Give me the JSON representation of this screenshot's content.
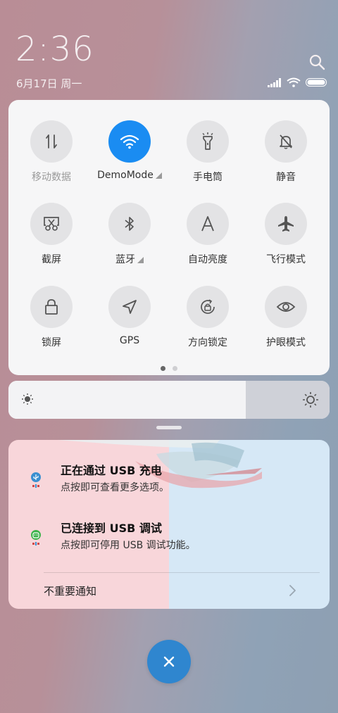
{
  "status": {
    "time": "2:36",
    "date": "6月17日 周一"
  },
  "quick_settings": {
    "tiles": [
      {
        "label": "移动数据",
        "icon": "mobile-data-icon",
        "active": false,
        "dim": true
      },
      {
        "label": "DemoMode",
        "icon": "wifi-icon",
        "active": true,
        "expand": true
      },
      {
        "label": "手电筒",
        "icon": "flashlight-icon",
        "active": false
      },
      {
        "label": "静音",
        "icon": "bell-off-icon",
        "active": false
      },
      {
        "label": "截屏",
        "icon": "screenshot-icon",
        "active": false
      },
      {
        "label": "蓝牙",
        "icon": "bluetooth-icon",
        "active": false,
        "expand": true
      },
      {
        "label": "自动亮度",
        "icon": "auto-brightness-icon",
        "active": false
      },
      {
        "label": "飞行模式",
        "icon": "airplane-icon",
        "active": false
      },
      {
        "label": "锁屏",
        "icon": "lock-icon",
        "active": false
      },
      {
        "label": "GPS",
        "icon": "location-icon",
        "active": false
      },
      {
        "label": "方向锁定",
        "icon": "rotation-lock-icon",
        "active": false
      },
      {
        "label": "护眼模式",
        "icon": "eye-icon",
        "active": false
      }
    ],
    "page_count": 2,
    "current_page": 1
  },
  "brightness": {
    "level": 0.74
  },
  "notifications": [
    {
      "title": "正在通过 USB 充电",
      "subtitle": "点按即可查看更多选项。",
      "icon": "usb-icon"
    },
    {
      "title": "已连接到 USB 调试",
      "subtitle": "点按即可停用 USB 调试功能。",
      "icon": "android-debug-icon"
    }
  ],
  "unimportant_label": "不重要通知",
  "colors": {
    "accent": "#1a8cf2",
    "fab": "#2f86cf"
  }
}
